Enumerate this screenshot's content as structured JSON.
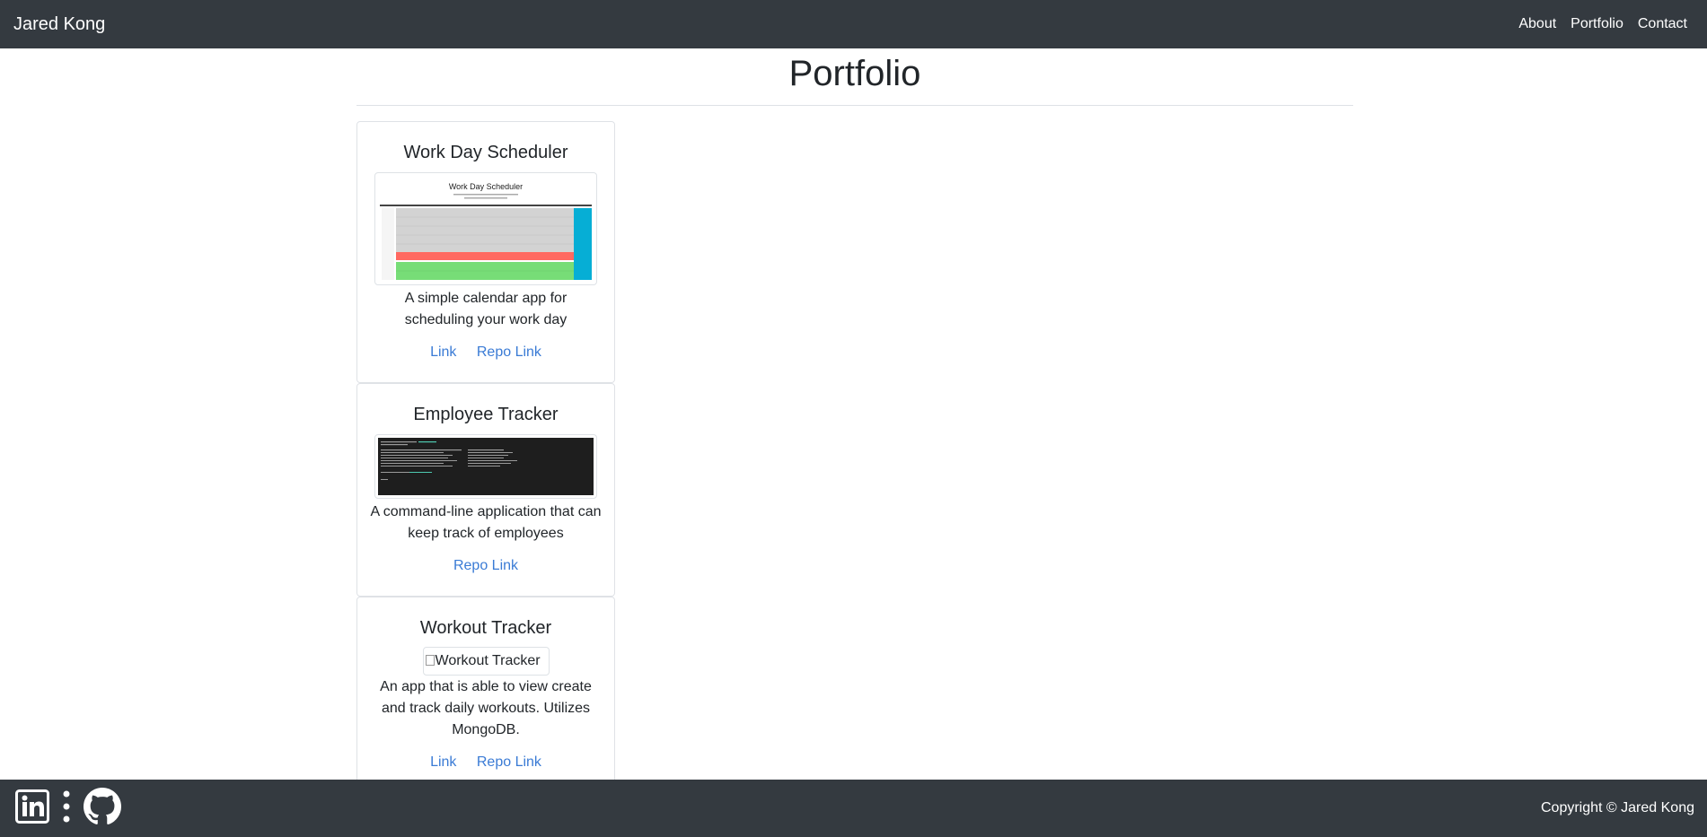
{
  "nav": {
    "brand": "Jared Kong",
    "links": [
      "About",
      "Portfolio",
      "Contact"
    ]
  },
  "page": {
    "title": "Portfolio"
  },
  "projects": [
    {
      "title": "Work Day Scheduler",
      "description": "A simple calendar app for scheduling your work day",
      "link_label": "Link",
      "repo_label": "Repo Link",
      "thumb_title": "Work Day Scheduler"
    },
    {
      "title": "Employee Tracker",
      "description": "A command-line application that can keep track of employees",
      "repo_label": "Repo Link"
    },
    {
      "title": "Workout Tracker",
      "image_alt": "Workout Tracker",
      "description": "An app that is able to view create and track daily workouts. Utilizes MongoDB.",
      "link_label": "Link",
      "repo_label": "Repo Link"
    }
  ],
  "footer": {
    "icons": [
      "linkedin-icon",
      "more-vertical-icon",
      "github-icon"
    ],
    "copyright": "Copyright © Jared Kong"
  },
  "colors": {
    "navbar_bg": "#343a40",
    "link": "#3a7bd5",
    "scheduler_current": "#ff6961",
    "scheduler_future": "#77dd77",
    "scheduler_save": "#06aed5"
  }
}
